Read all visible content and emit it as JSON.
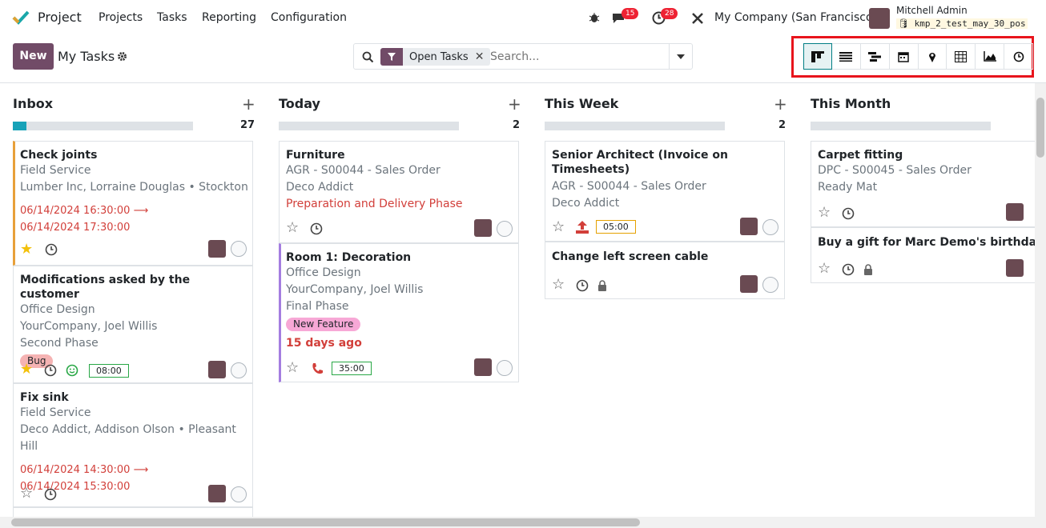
{
  "nav": {
    "app": "Project",
    "menus": [
      "Projects",
      "Tasks",
      "Reporting",
      "Configuration"
    ],
    "msg_badge": "15",
    "activity_badge": "28",
    "company": "My Company (San Francisco)",
    "user": "Mitchell Admin",
    "db": "kmp_2_test_may_30_pos"
  },
  "cp": {
    "new_label": "New",
    "title": "My Tasks",
    "facet": "Open Tasks",
    "search_placeholder": "Search..."
  },
  "views": [
    "kanban-icon",
    "list-icon",
    "gantt-icon",
    "calendar-icon",
    "map-icon",
    "pivot-icon",
    "graph-icon",
    "activity-icon"
  ],
  "columns": [
    {
      "name": "Inbox",
      "count": "27",
      "progress": 0.075,
      "progress_color": "#17a2b8"
    },
    {
      "name": "Today",
      "count": "2"
    },
    {
      "name": "This Week",
      "count": "2"
    },
    {
      "name": "This Month",
      "count": ""
    }
  ],
  "cards": {
    "c1": {
      "title": "Check joints",
      "l1": "Field Service",
      "l2": "Lumber Inc, Lorraine Douglas • Stockton",
      "d1": "06/14/2024 16:30:00",
      "d2": "06/14/2024 17:30:00"
    },
    "c2": {
      "title": "Modifications asked by the customer",
      "l1": "Office Design",
      "l2": "YourCompany, Joel Willis",
      "l3": "Second Phase",
      "tag": "Bug",
      "timer": "08:00"
    },
    "c3": {
      "title": "Fix sink",
      "l1": "Field Service",
      "l2": "Deco Addict, Addison Olson • Pleasant Hill",
      "d1": "06/14/2024 14:30:00",
      "d2": "06/14/2024 15:30:00"
    },
    "c4": {
      "title": "Furniture",
      "l1": "AGR - S00044 - Sales Order",
      "l2": "Deco Addict",
      "l3": "Preparation and Delivery Phase"
    },
    "c5": {
      "title": "Room 1: Decoration",
      "l1": "Office Design",
      "l2": "YourCompany, Joel Willis",
      "l3": "Final Phase",
      "tag": "New Feature",
      "deadline": "15 days ago",
      "timer": "35:00"
    },
    "c6": {
      "title1": "Senior Architect (Invoice on",
      "title2": "Timesheets)",
      "l1": "AGR - S00044 - Sales Order",
      "l2": "Deco Addict",
      "timer": "05:00"
    },
    "c7": {
      "title": "Change left screen cable"
    },
    "c8": {
      "title": "Carpet fitting",
      "l1": "DPC - S00045 - Sales Order",
      "l2": "Ready Mat"
    },
    "c9": {
      "title": "Buy a gift for Marc Demo's birthday"
    }
  }
}
